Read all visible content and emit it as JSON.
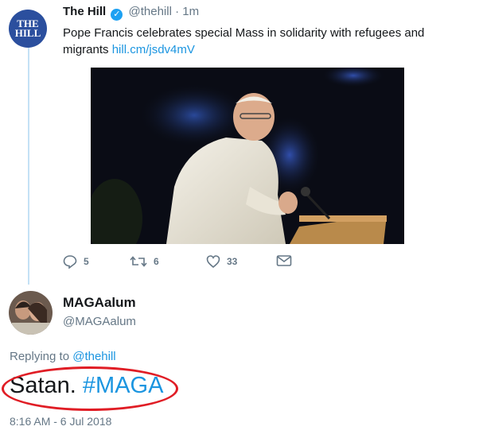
{
  "tweet": {
    "logo_text_1": "THE",
    "logo_text_2": "HILL",
    "author_name": "The Hill",
    "author_handle": "@thehill",
    "separator": "·",
    "time_ago": "1m",
    "text": "Pope Francis celebrates special Mass in solidarity with refugees and migrants",
    "link": "hill.cm/jsdv4mV",
    "actions": {
      "replies": "5",
      "retweets": "6",
      "likes": "33"
    }
  },
  "reply": {
    "name": "MAGAalum",
    "handle": "@MAGAalum",
    "replying_prefix": "Replying to",
    "replying_handle": "@thehill",
    "text_plain": "Satan.",
    "text_hashtag": "#MAGA",
    "timestamp": "8:16 AM - 6 Jul 2018"
  },
  "colors": {
    "accent": "#1b95e0",
    "thread_line": "#c4e1f5",
    "annotation_oval": "#e01d25"
  },
  "icons": {
    "verified": "verified-badge-icon",
    "reply": "reply-icon",
    "retweet": "retweet-icon",
    "like": "heart-icon",
    "dm": "envelope-icon"
  }
}
